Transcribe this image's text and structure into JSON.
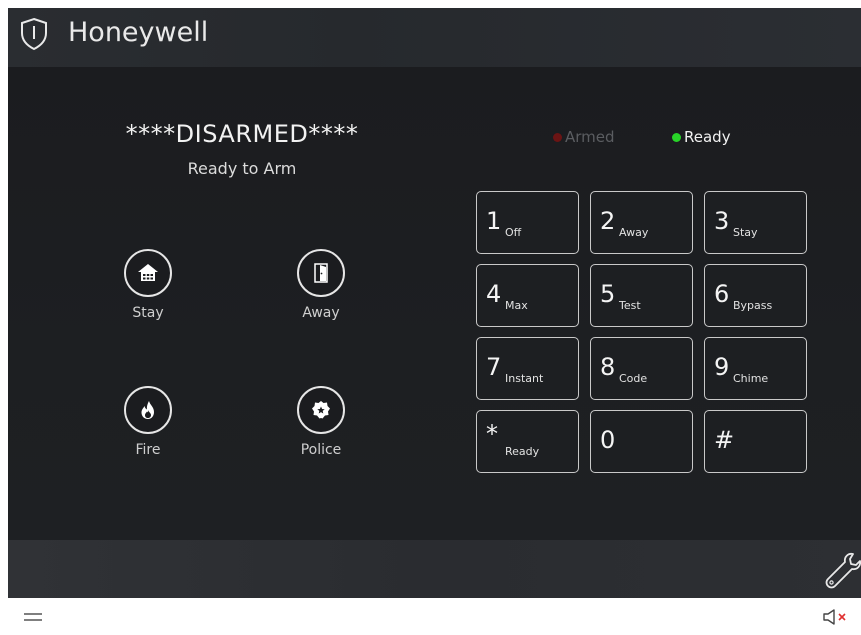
{
  "header": {
    "brand": "Honeywell"
  },
  "status": {
    "main": "****DISARMED****",
    "sub": "Ready to Arm"
  },
  "indicators": {
    "armed": "Armed",
    "ready": "Ready"
  },
  "actions": [
    {
      "label": "Stay",
      "icon": "home-icon"
    },
    {
      "label": "Away",
      "icon": "door-icon"
    },
    {
      "label": "Fire",
      "icon": "fire-icon"
    },
    {
      "label": "Police",
      "icon": "police-badge-icon"
    }
  ],
  "keypad": [
    {
      "num": "1",
      "sub": "Off"
    },
    {
      "num": "2",
      "sub": "Away"
    },
    {
      "num": "3",
      "sub": "Stay"
    },
    {
      "num": "4",
      "sub": "Max"
    },
    {
      "num": "5",
      "sub": "Test"
    },
    {
      "num": "6",
      "sub": "Bypass"
    },
    {
      "num": "7",
      "sub": "Instant"
    },
    {
      "num": "8",
      "sub": "Code"
    },
    {
      "num": "9",
      "sub": "Chime"
    },
    {
      "num": "*",
      "sub": "Ready"
    },
    {
      "num": "0",
      "sub": ""
    },
    {
      "num": "#",
      "sub": ""
    }
  ],
  "colors": {
    "ready_dot": "#28d428",
    "armed_dot": "#6b1414",
    "mute_x": "#e03030"
  }
}
